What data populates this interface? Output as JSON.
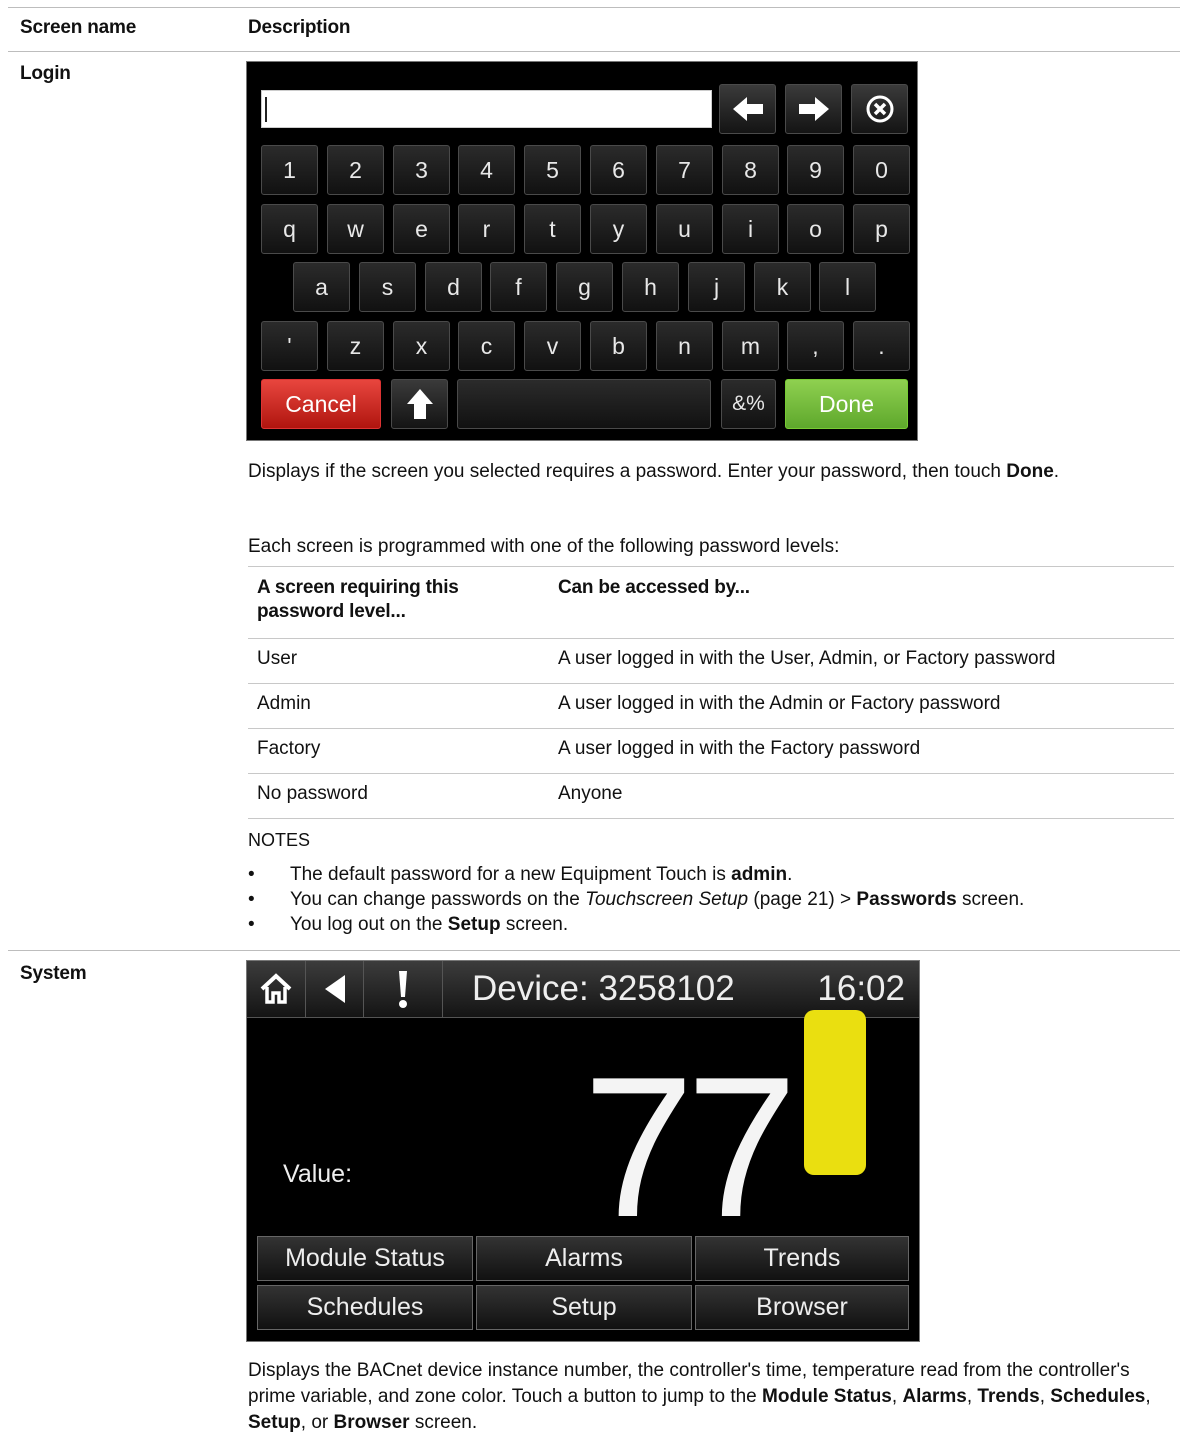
{
  "table_header": {
    "col1": "Screen name",
    "col2": "Description"
  },
  "login": {
    "name": "Login",
    "keypad": {
      "input_value": "",
      "row_numbers": [
        "1",
        "2",
        "3",
        "4",
        "5",
        "6",
        "7",
        "8",
        "9",
        "0"
      ],
      "row_q": [
        "q",
        "w",
        "e",
        "r",
        "t",
        "y",
        "u",
        "i",
        "o",
        "p"
      ],
      "row_a": [
        "a",
        "s",
        "d",
        "f",
        "g",
        "h",
        "j",
        "k",
        "l"
      ],
      "row_z": [
        "'",
        "z",
        "x",
        "c",
        "v",
        "b",
        "n",
        "m",
        ",",
        "."
      ],
      "cancel": "Cancel",
      "symbols": "&%",
      "done": "Done"
    },
    "para1_text": "Displays if the screen you selected requires a password. Enter your password, then touch ",
    "para1_bold": "Done",
    "para1_end": ".",
    "para2": "Each screen is programmed with one of the following password levels:",
    "levels_table": {
      "headers": [
        "A screen requiring this password level...",
        "Can be accessed by..."
      ],
      "rows": [
        [
          "User",
          "A user logged in with the User, Admin, or Factory password"
        ],
        [
          "Admin",
          "A user logged in with the Admin or Factory password"
        ],
        [
          "Factory",
          "A user logged in with the Factory password"
        ],
        [
          "No password",
          "Anyone"
        ]
      ]
    },
    "notes_label": "NOTES",
    "notes": {
      "n1_text": "The default password for a new Equipment Touch is ",
      "n1_bold": "admin",
      "n1_end": ".",
      "n2_text": "You can change passwords on the ",
      "n2_italic": "Touchscreen Setup",
      "n2_mid": " (page 21) > ",
      "n2_bold": "Passwords",
      "n2_end": " screen.",
      "n3_text": "You log out on the ",
      "n3_bold": "Setup",
      "n3_end": " screen."
    }
  },
  "system": {
    "name": "System",
    "screen": {
      "device_label": "Device:",
      "device_number": "3258102",
      "time": "16:02",
      "value_label": "Value:",
      "value": "77",
      "zone_color": "#eadf10",
      "buttons": [
        "Module Status",
        "Alarms",
        "Trends",
        "Schedules",
        "Setup",
        "Browser"
      ]
    },
    "desc": {
      "t1": "Displays the BACnet device instance number, the controller's time, temperature read from the controller's prime variable, and zone color. Touch a button to jump to the ",
      "b1": "Module Status",
      "s1": ", ",
      "b2": "Alarms",
      "s2": ", ",
      "b3": "Trends",
      "s3": ", ",
      "b4": "Schedules",
      "s4": ", ",
      "b5": "Setup",
      "s5": ", or ",
      "b6": "Browser",
      "t2": " screen."
    }
  }
}
